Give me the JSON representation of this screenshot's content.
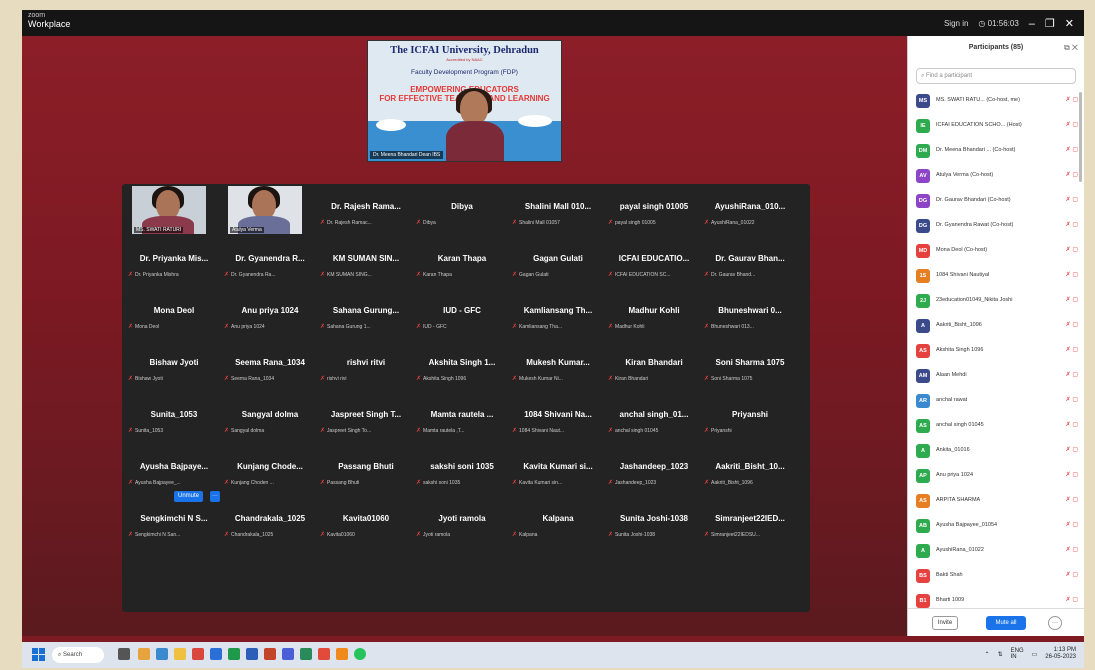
{
  "titlebar": {
    "app_line1": "zoom",
    "app_line2": "Workplace",
    "signin": "Sign in",
    "timer": "01:56:03",
    "minimize": "–",
    "restore": "❐",
    "close": "✕"
  },
  "speaker": {
    "university": "The ICFAI University, Dehradun",
    "university_sub": "Accredited by NAAC",
    "program": "Faculty Development Program (FDP)",
    "theme_line1": "EMPOWERING EDUCATORS",
    "theme_line2": "FOR EFFECTIVE TEACHING AND LEARNING",
    "label": "Dr. Meena Bhandari Dean IBS"
  },
  "gallery": {
    "video_tiles": [
      {
        "label": "MS. SWATI RATURI"
      },
      {
        "label": "Atulya Verma"
      }
    ],
    "tiles": [
      {
        "name": "Dr. Rajesh Rama...",
        "label": "Dr. Rajesh Ramac..."
      },
      {
        "name": "Dibya",
        "label": "Dibya"
      },
      {
        "name": "Shalini Mall 010...",
        "label": "Shalini Mall 01057"
      },
      {
        "name": "payal singh 01005",
        "label": "payal singh 01005"
      },
      {
        "name": "AyushiRana_010...",
        "label": "AyushiRana_01022"
      },
      {
        "name": "Dr. Priyanka Mis...",
        "label": "Dr. Priyanka Mishra"
      },
      {
        "name": "Dr. Gyanendra R...",
        "label": "Dr. Gyanendra Ra..."
      },
      {
        "name": "KM SUMAN SIN...",
        "label": "KM SUMAN SING..."
      },
      {
        "name": "Karan Thapa",
        "label": "Karan Thapa"
      },
      {
        "name": "Gagan Gulati",
        "label": "Gagan Gulati"
      },
      {
        "name": "ICFAI EDUCATIO...",
        "label": "ICFAI EDUCATION SC..."
      },
      {
        "name": "Dr. Gaurav Bhan...",
        "label": "Dr. Gaurav Bhand..."
      },
      {
        "name": "Mona Deol",
        "label": "Mona Deol"
      },
      {
        "name": "Anu priya 1024",
        "label": "Anu priya 1024"
      },
      {
        "name": "Sahana Gurung...",
        "label": "Sahana Gurung 1..."
      },
      {
        "name": "IUD - GFC",
        "label": "IUD - GFC"
      },
      {
        "name": "Kamliansang Th...",
        "label": "Kamliansang Tha..."
      },
      {
        "name": "Madhur Kohli",
        "label": "Madhur Kohli"
      },
      {
        "name": "Bhuneshwari 0...",
        "label": "Bhuneshwari 013..."
      },
      {
        "name": "Bishaw Jyoti",
        "label": "Bishaw Jyoti"
      },
      {
        "name": "Seema Rana_1034",
        "label": "Seema Rana_1034"
      },
      {
        "name": "rishvi ritvi",
        "label": "rishvi rivi"
      },
      {
        "name": "Akshita Singh 1...",
        "label": "Akshita Singh 1096"
      },
      {
        "name": "Mukesh Kumar...",
        "label": "Mukesh Kumar Ni..."
      },
      {
        "name": "Kiran Bhandari",
        "label": "Kiran Bhandari"
      },
      {
        "name": "Soni Sharma 1075",
        "label": "Soni Sharma 1075"
      },
      {
        "name": "Sunita_1053",
        "label": "Sunita_1053"
      },
      {
        "name": "Sangyal dolma",
        "label": "Sangyal dolma"
      },
      {
        "name": "Jaspreet Singh T...",
        "label": "Jaspreet Singh To..."
      },
      {
        "name": "Mamta rautela ...",
        "label": "Mamta rautela ,T..."
      },
      {
        "name": "1084 Shivani Na...",
        "label": "1084 Shivani Naut..."
      },
      {
        "name": "anchal singh_01...",
        "label": "anchal singh 01045"
      },
      {
        "name": "Priyanshi",
        "label": "Priyanshi"
      },
      {
        "name": "Ayusha Bajpaye...",
        "label": "Ayusha Bajpayee_..."
      },
      {
        "name": "Kunjang Chode...",
        "label": "Kunjang Choden ..."
      },
      {
        "name": "Passang Bhuti",
        "label": "Passang Bhuti"
      },
      {
        "name": "sakshi soni 1035",
        "label": "sakshi soni 1035"
      },
      {
        "name": "Kavita Kumari si...",
        "label": "Kavita Kumari sin..."
      },
      {
        "name": "Jashandeep_1023",
        "label": "Jashandeep_1023"
      },
      {
        "name": "Aakriti_Bisht_10...",
        "label": "Aakriti_Bisht_1096"
      },
      {
        "name": "Sengkimchi N S...",
        "label": "Sengkimchi N San..."
      },
      {
        "name": "Chandrakala_1025",
        "label": "Chandrakala_1025"
      },
      {
        "name": "Kavita01060",
        "label": "Kavita01060"
      },
      {
        "name": "Jyoti ramola",
        "label": "Jyoti ramola"
      },
      {
        "name": "Kalpana",
        "label": "Kalpana"
      },
      {
        "name": "Sunita Joshi-1038",
        "label": "Sunita Joshi-1038"
      },
      {
        "name": "Simranjeet22IED...",
        "label": "Simranjeet22IEDSU..."
      }
    ],
    "unmute_label": "Unmute",
    "more_label": "···"
  },
  "panel": {
    "title": "Participants (85)",
    "icons": "⧉  ✕",
    "search_placeholder": "Find a participant",
    "participants": [
      {
        "initials": "MS",
        "color": "#3b4a8a",
        "name": "MS. SWATI RATU... (Co-host, me)"
      },
      {
        "initials": "IE",
        "color": "#2eaa4f",
        "name": "ICFAI EDUCATION SCHO... (Host)"
      },
      {
        "initials": "DM",
        "color": "#2eaa4f",
        "name": "Dr. Meena Bhandari ... (Co-host)"
      },
      {
        "initials": "AV",
        "color": "#8e44c7",
        "name": "Atulya Verma (Co-host)"
      },
      {
        "initials": "DG",
        "color": "#8e44c7",
        "name": "Dr. Gaurav Bhandari (Co-host)"
      },
      {
        "initials": "DG",
        "color": "#3b4a8a",
        "name": "Dr. Gyanendra Rawat (Co-host)"
      },
      {
        "initials": "MD",
        "color": "#e5413e",
        "name": "Mona Deol (Co-host)"
      },
      {
        "initials": "1S",
        "color": "#e67e22",
        "name": "1084 Shivani Nautiyal"
      },
      {
        "initials": "2J",
        "color": "#2eaa4f",
        "name": "23education01049_Nikita Joshi"
      },
      {
        "initials": "A",
        "color": "#3b4a8a",
        "name": "Aakriti_Bisht_1096"
      },
      {
        "initials": "AS",
        "color": "#e5413e",
        "name": "Akshita Singh 1096"
      },
      {
        "initials": "AM",
        "color": "#3b4a8a",
        "name": "Alaan Mehdi"
      },
      {
        "initials": "AR",
        "color": "#3b8ad0",
        "name": "anchal rawat"
      },
      {
        "initials": "AS",
        "color": "#2eaa4f",
        "name": "anchal singh 01045"
      },
      {
        "initials": "A",
        "color": "#2eaa4f",
        "name": "Ankita_01016"
      },
      {
        "initials": "AP",
        "color": "#2eaa4f",
        "name": "Anu priya 1024"
      },
      {
        "initials": "AS",
        "color": "#e67e22",
        "name": "ARPITA SHARMA"
      },
      {
        "initials": "AB",
        "color": "#2eaa4f",
        "name": "Ayusha Bajpayee_01054"
      },
      {
        "initials": "A",
        "color": "#2eaa4f",
        "name": "AyushiRana_01022"
      },
      {
        "initials": "BS",
        "color": "#e5413e",
        "name": "Bakti Shah"
      },
      {
        "initials": "B1",
        "color": "#e5413e",
        "name": "Bharti 1009"
      }
    ],
    "invite_label": "Invite",
    "mute_all_label": "Mute all",
    "more_label": "···"
  },
  "taskbar": {
    "search_label": "Search",
    "lang": "ENG",
    "lang_sub": "IN",
    "time": "1:13 PM",
    "date": "26-05-2023"
  }
}
